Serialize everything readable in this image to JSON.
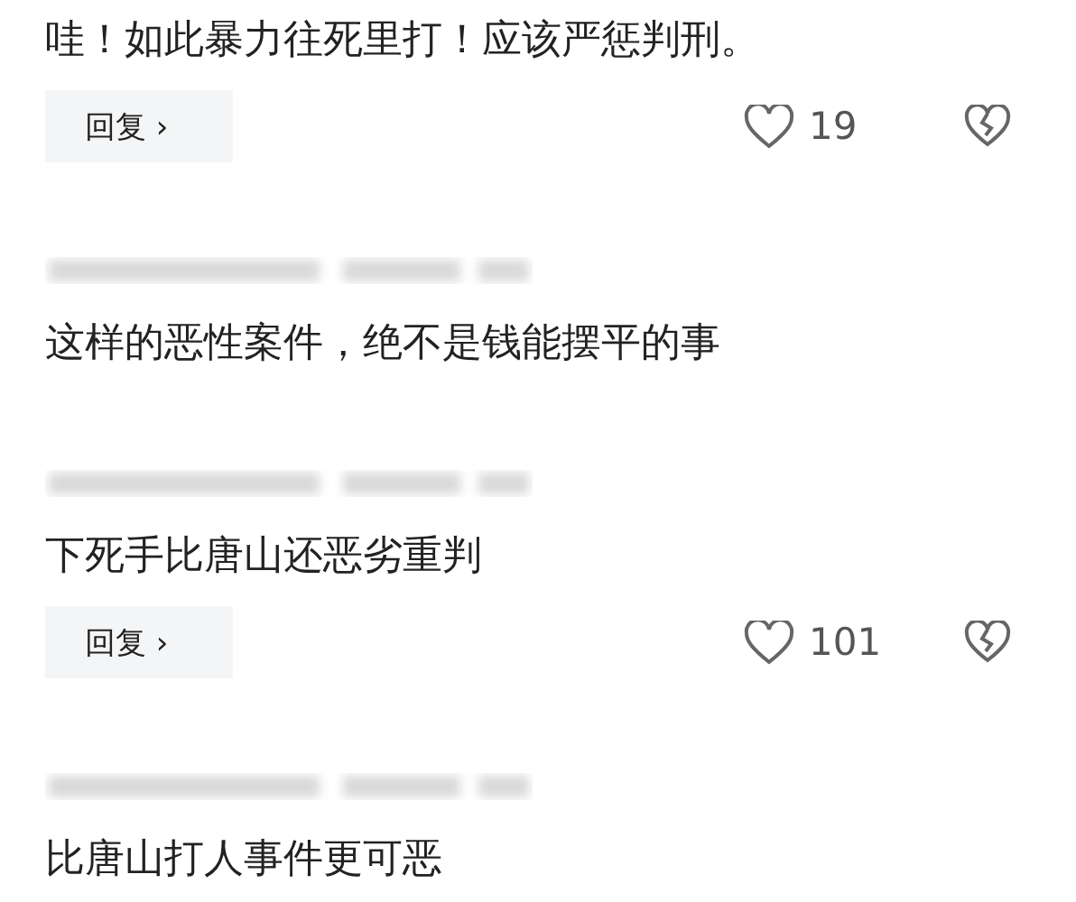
{
  "comments": [
    {
      "show_author": false,
      "text": "哇！如此暴力往死里打！应该严惩判刑。",
      "actions": {
        "reply": "回复 ›",
        "likes": "19"
      }
    },
    {
      "show_author": true,
      "text": "这样的恶性案件，绝不是钱能摆平的事"
    },
    {
      "show_author": true,
      "text": "下死手比唐山还恶劣重判",
      "actions": {
        "reply": "回复 ›",
        "likes": "101"
      }
    },
    {
      "show_author": true,
      "text": "比唐山打人事件更可恶"
    }
  ]
}
